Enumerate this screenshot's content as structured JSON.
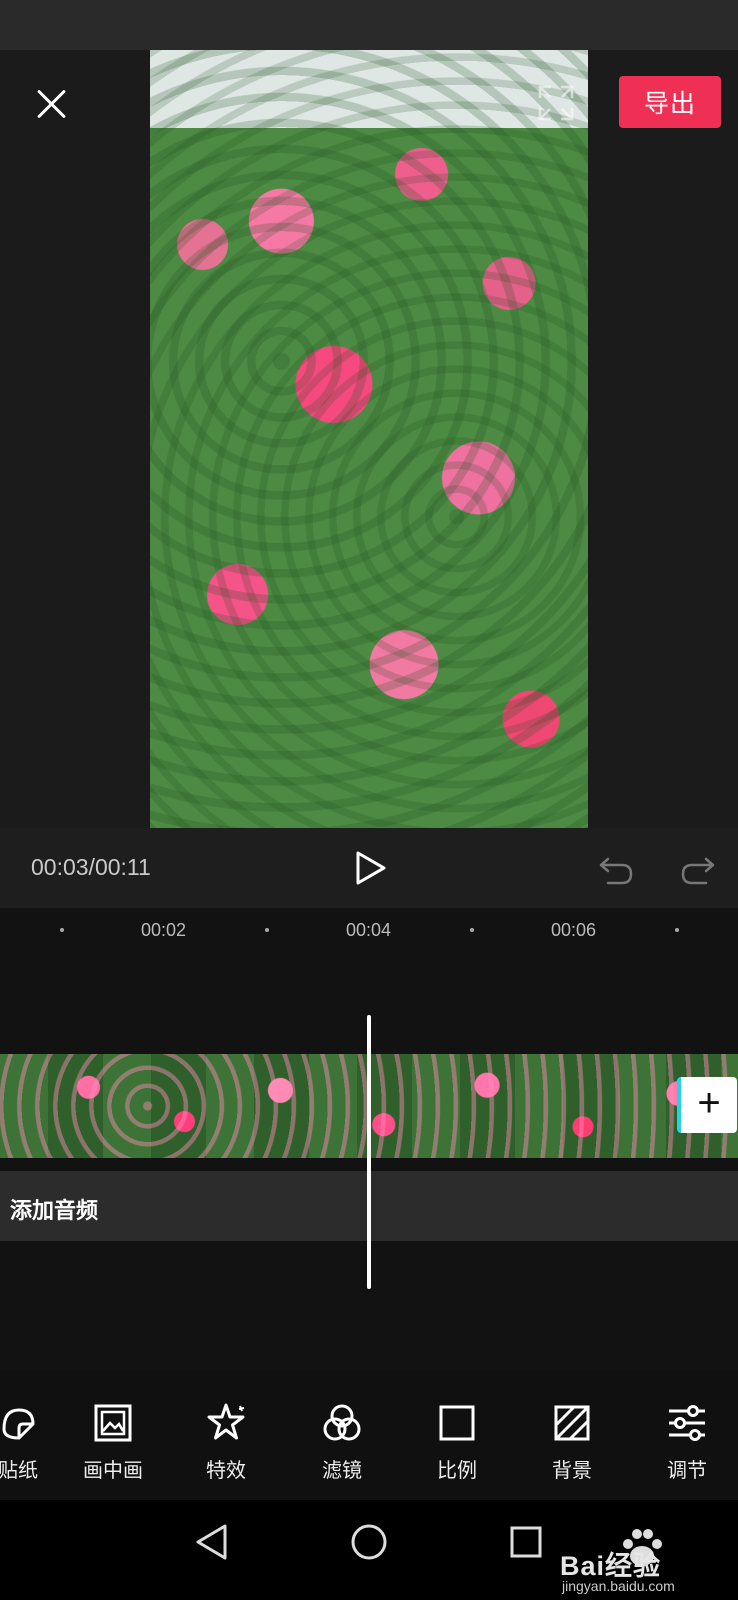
{
  "header": {
    "export_label": "导出",
    "close_icon": "close-icon",
    "expand_icon": "fullscreen-expand-icon"
  },
  "player": {
    "time": "00:03/00:11",
    "play_icon": "play-icon",
    "undo_icon": "undo-icon",
    "redo_icon": "redo-icon"
  },
  "timeline": {
    "ticks": [
      "00:02",
      "00:04",
      "00:06"
    ],
    "audio_label": "添加音频",
    "add_clip_symbol": "+"
  },
  "toolbar": {
    "items": [
      {
        "label": "贴纸",
        "icon": "sticker-icon"
      },
      {
        "label": "画中画",
        "icon": "picture-in-picture-icon"
      },
      {
        "label": "特效",
        "icon": "effects-star-icon"
      },
      {
        "label": "滤镜",
        "icon": "filter-icon"
      },
      {
        "label": "比例",
        "icon": "ratio-icon"
      },
      {
        "label": "背景",
        "icon": "background-icon"
      },
      {
        "label": "调节",
        "icon": "adjust-sliders-icon"
      }
    ]
  },
  "watermark": {
    "text": "Bai经验",
    "url": "jingyan.baidu.com"
  },
  "colors": {
    "accent": "#f02f55",
    "background": "#121212",
    "panel": "#1e1e1e"
  }
}
